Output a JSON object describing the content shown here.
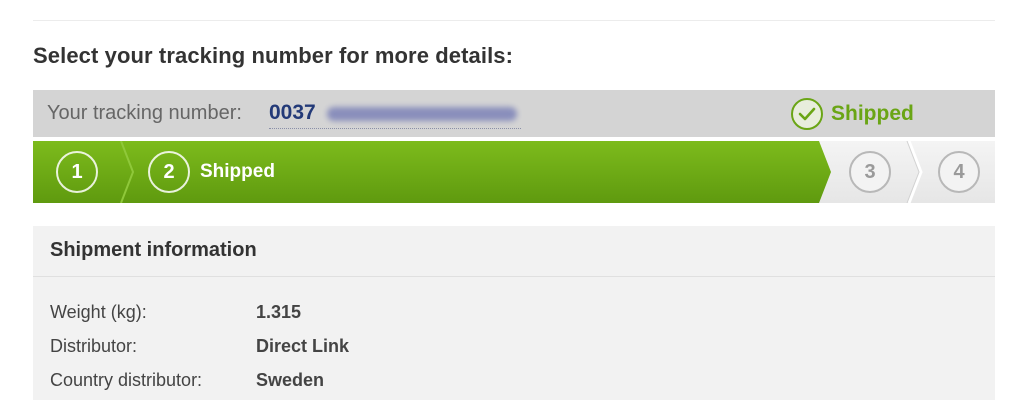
{
  "heading": "Select your tracking number for more details:",
  "tracking": {
    "label": "Your tracking number:",
    "number_visible": "0037",
    "status_icon": "check-circle-icon",
    "status": "Shipped"
  },
  "progress": {
    "current_step": 2,
    "total_steps": 4,
    "colors": {
      "active": "#6aa515",
      "inactive": "#e8e8e8"
    },
    "steps": [
      {
        "number": "1",
        "label": ""
      },
      {
        "number": "2",
        "label": "Shipped"
      },
      {
        "number": "3",
        "label": ""
      },
      {
        "number": "4",
        "label": ""
      }
    ]
  },
  "shipment": {
    "title": "Shipment information",
    "rows": [
      {
        "key": "Weight (kg):",
        "value": "1.315"
      },
      {
        "key": "Distributor:",
        "value": "Direct Link"
      },
      {
        "key": "Country distributor:",
        "value": "Sweden"
      }
    ]
  }
}
